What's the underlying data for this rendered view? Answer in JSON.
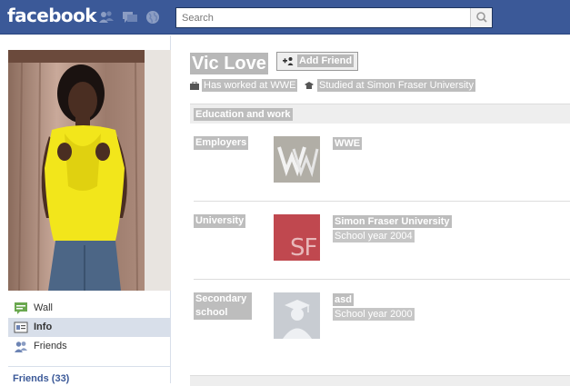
{
  "header": {
    "logo": "facebook",
    "search": {
      "placeholder": "Search"
    }
  },
  "left_nav": {
    "items": [
      {
        "label": "Wall",
        "icon": "wall-icon"
      },
      {
        "label": "Info",
        "icon": "info-icon",
        "selected": true
      },
      {
        "label": "Friends",
        "icon": "friends-icon"
      }
    ],
    "friends_link": "Friends (33)"
  },
  "profile": {
    "name": "Vic Love",
    "add_friend_label": "Add Friend",
    "summary": {
      "work": "Has worked at WWE",
      "study": "Studied at Simon Fraser University"
    }
  },
  "education_work": {
    "header": "Education and work",
    "rows": [
      {
        "label": "Employers",
        "title": "WWE",
        "sub": ""
      },
      {
        "label": "University",
        "title": "Simon Fraser University",
        "sub": "School year 2004",
        "thumb_text": "SF"
      },
      {
        "label": "Secondary school",
        "title": "asd",
        "sub": "School year 2000"
      }
    ]
  },
  "colors": {
    "brand": "#3b5998",
    "nav_selected": "#d8dfea",
    "sfu_red": "#c0484f"
  }
}
